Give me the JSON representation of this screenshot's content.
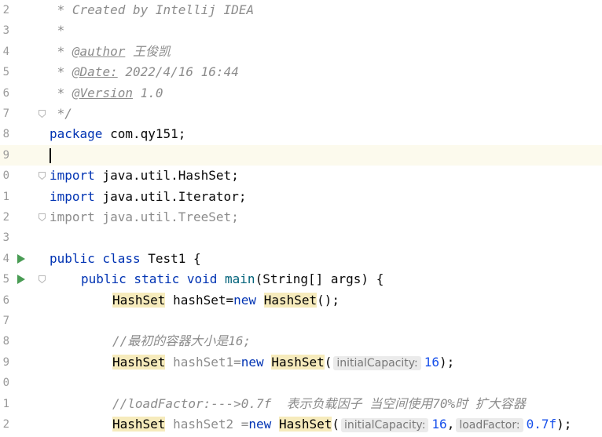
{
  "editor": {
    "lines": [
      {
        "num": "2",
        "fold": false,
        "run": false,
        "current": false,
        "indent": 0,
        "tokens": [
          {
            "t": " * Created by Intellij IDEA",
            "c": "comment"
          }
        ]
      },
      {
        "num": "3",
        "fold": false,
        "run": false,
        "current": false,
        "indent": 0,
        "tokens": [
          {
            "t": " *",
            "c": "comment"
          }
        ]
      },
      {
        "num": "4",
        "fold": false,
        "run": false,
        "current": false,
        "indent": 0,
        "tokens": [
          {
            "t": " * ",
            "c": "comment"
          },
          {
            "t": "@author",
            "c": "doctag"
          },
          {
            "t": " 王俊凯",
            "c": "comment"
          }
        ]
      },
      {
        "num": "5",
        "fold": false,
        "run": false,
        "current": false,
        "indent": 0,
        "tokens": [
          {
            "t": " * ",
            "c": "comment"
          },
          {
            "t": "@Date:",
            "c": "doctag"
          },
          {
            "t": " 2022/4/16 16:44",
            "c": "comment"
          }
        ]
      },
      {
        "num": "6",
        "fold": false,
        "run": false,
        "current": false,
        "indent": 0,
        "tokens": [
          {
            "t": " * ",
            "c": "comment"
          },
          {
            "t": "@Version",
            "c": "doctag"
          },
          {
            "t": " 1.0",
            "c": "comment"
          }
        ]
      },
      {
        "num": "7",
        "fold": true,
        "run": false,
        "current": false,
        "indent": 0,
        "tokens": [
          {
            "t": " */",
            "c": "comment"
          }
        ]
      },
      {
        "num": "8",
        "fold": false,
        "run": false,
        "current": false,
        "indent": 0,
        "tokens": [
          {
            "t": "package",
            "c": "kw"
          },
          {
            "t": " com.qy151;",
            "c": "plain"
          }
        ]
      },
      {
        "num": "9",
        "fold": false,
        "run": false,
        "current": true,
        "indent": 0,
        "caret": true,
        "tokens": []
      },
      {
        "num": "0",
        "fold": true,
        "run": false,
        "current": false,
        "indent": 0,
        "tokens": [
          {
            "t": "import",
            "c": "kw"
          },
          {
            "t": " java.util.HashSet;",
            "c": "plain"
          }
        ]
      },
      {
        "num": "1",
        "fold": false,
        "run": false,
        "current": false,
        "indent": 0,
        "tokens": [
          {
            "t": "import",
            "c": "kw"
          },
          {
            "t": " java.util.Iterator;",
            "c": "plain"
          }
        ]
      },
      {
        "num": "2",
        "fold": true,
        "run": false,
        "current": false,
        "indent": 0,
        "tokens": [
          {
            "t": "import java.util.TreeSet;",
            "c": "unused"
          }
        ]
      },
      {
        "num": "3",
        "fold": false,
        "run": false,
        "current": false,
        "indent": 0,
        "tokens": []
      },
      {
        "num": "4",
        "fold": false,
        "run": true,
        "current": false,
        "indent": 0,
        "tokens": [
          {
            "t": "public class",
            "c": "kw"
          },
          {
            "t": " Test1 {",
            "c": "plain"
          }
        ]
      },
      {
        "num": "5",
        "fold": true,
        "run": true,
        "current": false,
        "indent": 1,
        "tokens": [
          {
            "t": "public static void",
            "c": "kw"
          },
          {
            "t": " ",
            "c": "plain"
          },
          {
            "t": "main",
            "c": "method"
          },
          {
            "t": "(String[] args) {",
            "c": "plain"
          }
        ]
      },
      {
        "num": "6",
        "fold": false,
        "run": false,
        "current": false,
        "indent": 2,
        "tokens": [
          {
            "t": "HashSet",
            "c": "cls"
          },
          {
            "t": " hashSet=",
            "c": "plain"
          },
          {
            "t": "new",
            "c": "kw"
          },
          {
            "t": " ",
            "c": "plain"
          },
          {
            "t": "HashSet",
            "c": "cls"
          },
          {
            "t": "();",
            "c": "plain"
          }
        ]
      },
      {
        "num": "7",
        "fold": false,
        "run": false,
        "current": false,
        "indent": 0,
        "tokens": []
      },
      {
        "num": "8",
        "fold": false,
        "run": false,
        "current": false,
        "indent": 2,
        "tokens": [
          {
            "t": "//最初的容器大小是16;",
            "c": "comment"
          }
        ]
      },
      {
        "num": "9",
        "fold": false,
        "run": false,
        "current": false,
        "indent": 2,
        "tokens": [
          {
            "t": "HashSet",
            "c": "cls"
          },
          {
            "t": " hashSet1=",
            "c": "grey"
          },
          {
            "t": "new",
            "c": "kw"
          },
          {
            "t": " ",
            "c": "plain"
          },
          {
            "t": "HashSet",
            "c": "cls"
          },
          {
            "t": "(",
            "c": "plain"
          },
          {
            "t": "initialCapacity:",
            "c": "hint"
          },
          {
            "t": "16",
            "c": "num"
          },
          {
            "t": ");",
            "c": "plain"
          }
        ]
      },
      {
        "num": "0",
        "fold": false,
        "run": false,
        "current": false,
        "indent": 0,
        "tokens": []
      },
      {
        "num": "1",
        "fold": false,
        "run": false,
        "current": false,
        "indent": 2,
        "tokens": [
          {
            "t": "//loadFactor:--->0.7f  表示负载因子 当空间使用70%时 扩大容器",
            "c": "comment"
          }
        ]
      },
      {
        "num": "2",
        "fold": false,
        "run": false,
        "current": false,
        "indent": 2,
        "tokens": [
          {
            "t": "HashSet",
            "c": "cls"
          },
          {
            "t": " hashSet2 =",
            "c": "grey"
          },
          {
            "t": "new",
            "c": "kw"
          },
          {
            "t": " ",
            "c": "plain"
          },
          {
            "t": "HashSet",
            "c": "cls"
          },
          {
            "t": "(",
            "c": "plain"
          },
          {
            "t": "initialCapacity:",
            "c": "hint"
          },
          {
            "t": "16",
            "c": "num"
          },
          {
            "t": ",",
            "c": "plain"
          },
          {
            "t": "loadFactor:",
            "c": "hint"
          },
          {
            "t": "0.7f",
            "c": "num"
          },
          {
            "t": ");",
            "c": "plain"
          }
        ]
      }
    ]
  }
}
